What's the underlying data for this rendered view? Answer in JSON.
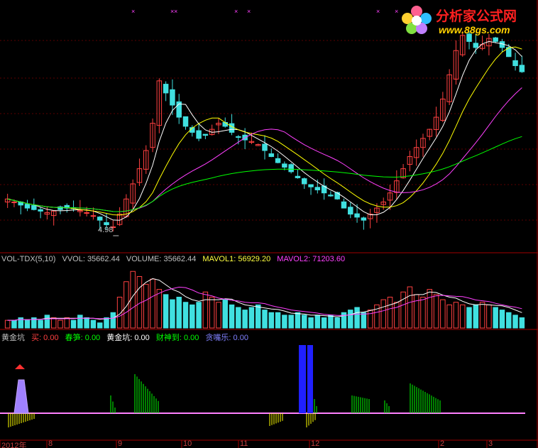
{
  "chart_data": {
    "type": "candlestick",
    "panels": [
      {
        "name": "price",
        "series": [
          {
            "name": "close",
            "color": "#ff4040",
            "values": [
              5.9,
              5.8,
              5.7,
              5.6,
              5.55,
              5.5,
              5.45,
              5.5,
              5.55,
              5.6,
              5.58,
              5.52,
              5.45,
              5.35,
              5.2,
              5.05,
              4.98,
              5.4,
              5.9,
              6.4,
              6.9,
              7.5,
              8.4,
              9.8,
              9.4,
              9.0,
              8.6,
              8.3,
              8.1,
              7.9,
              8.0,
              8.2,
              8.4,
              8.3,
              8.1,
              7.95,
              7.85,
              7.8,
              7.7,
              7.5,
              7.3,
              7.1,
              6.95,
              6.8,
              6.6,
              6.4,
              6.3,
              6.2,
              6.1,
              6.0,
              5.9,
              5.6,
              5.4,
              5.3,
              5.2,
              5.4,
              5.6,
              5.8,
              6.1,
              6.5,
              6.9,
              7.3,
              7.6,
              7.9,
              8.2,
              8.6,
              9.2,
              10.0,
              10.8,
              11.3,
              11.1,
              10.9,
              11.0,
              11.2,
              11.1,
              10.9,
              10.6,
              10.3,
              10.1
            ]
          },
          {
            "name": "MA5",
            "color": "#ffffff"
          },
          {
            "name": "MA10",
            "color": "#ffff00"
          },
          {
            "name": "MA20",
            "color": "#ff40ff"
          },
          {
            "name": "MA60",
            "color": "#00ff00"
          }
        ],
        "annotations": [
          {
            "text": "4.98",
            "at": "low"
          }
        ]
      },
      {
        "name": "volume",
        "indicator": "VOL-TDX(5,10)",
        "values": [
          3,
          3,
          4,
          3,
          4,
          3,
          5,
          4,
          3,
          4,
          3,
          5,
          4,
          3,
          2,
          4,
          6,
          12,
          18,
          22,
          20,
          17,
          19,
          15,
          13,
          11,
          12,
          10,
          9,
          10,
          14,
          12,
          10,
          11,
          9,
          8,
          7,
          8,
          9,
          7,
          6,
          6,
          5,
          5,
          6,
          5,
          4,
          5,
          4,
          5,
          4,
          6,
          7,
          8,
          6,
          7,
          9,
          11,
          12,
          10,
          14,
          16,
          13,
          12,
          15,
          13,
          11,
          9,
          10,
          9,
          8,
          9,
          10,
          9,
          8,
          7,
          6,
          5,
          4
        ]
      },
      {
        "name": "indicator",
        "indicator": "黄金坑"
      }
    ],
    "x_labels": [
      "2012年",
      "8",
      "9",
      "10",
      "11",
      "12",
      "2",
      "3"
    ]
  },
  "vol_info": {
    "name": "VOL-TDX(5,10)",
    "vvol": "VVOL: 35662.44",
    "volume": "VOLUME: 35662.44",
    "mavol1": "MAVOL1: 56929.20",
    "mavol2": "MAVOL2: 71203.60"
  },
  "ind_info": {
    "name": "黄金坑",
    "buy": "买",
    "buy_val": ": 0.00",
    "chunsun": "春笋: 0.00",
    "huangjinkeng": "黄金坑: 0.00",
    "caishen": "财神到: 0.00",
    "tanzui": "贪嘴乐: 0.00"
  },
  "price_label": "4.98",
  "logo": {
    "title": "分析家公式网",
    "url": "www.88gs.com"
  },
  "colors": {
    "up": "#ff4040",
    "down": "#40e0e0",
    "ma5": "#ffffff",
    "ma10": "#ffff00",
    "ma20": "#ff40ff",
    "ma60": "#00ff00",
    "panel_line": "#a00000",
    "gold_buy": "#2020ff",
    "spring": "#00ff00",
    "yellow": "#ffff00"
  }
}
